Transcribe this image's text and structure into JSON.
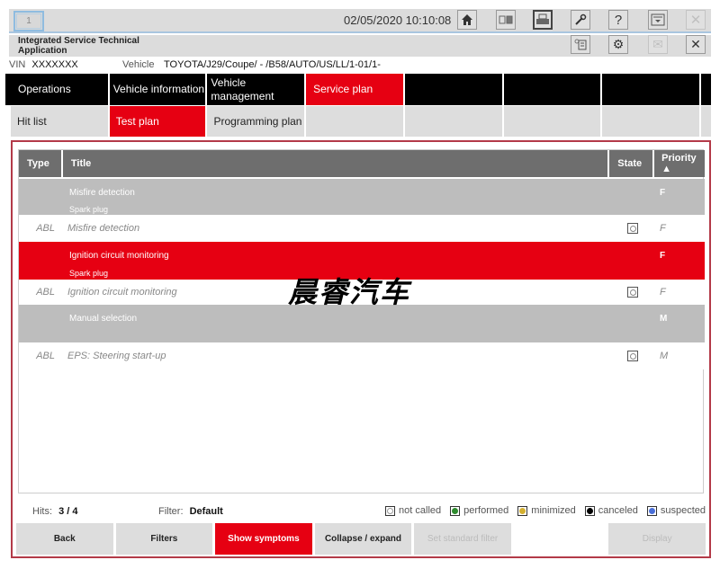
{
  "topbar": {
    "session_tab": "1",
    "datetime": "02/05/2020 10:10:08",
    "buttons": [
      {
        "name": "home",
        "icon": "⌂"
      },
      {
        "name": "split-view",
        "icon": "▫▪"
      },
      {
        "name": "print",
        "icon": "▤"
      },
      {
        "name": "wrench",
        "icon": "🔧"
      },
      {
        "name": "help",
        "icon": "?"
      },
      {
        "name": "download",
        "icon": "⤓"
      },
      {
        "name": "close-disabled",
        "icon": "✕"
      }
    ]
  },
  "appbar": {
    "title_line1": "Integrated Service Technical",
    "title_line2": "Application",
    "buttons": [
      {
        "name": "documents",
        "icon": "❐"
      },
      {
        "name": "settings",
        "icon": "⚙"
      },
      {
        "name": "mail",
        "icon": "✉"
      },
      {
        "name": "close",
        "icon": "✕"
      }
    ]
  },
  "vehicle": {
    "vin_label": "VIN",
    "vin_value": "XXXXXXX",
    "vehicle_label": "Vehicle",
    "vehicle_value": "TOYOTA/J29/Coupe/ - /B58/AUTO/US/LL/1-01/1-"
  },
  "nav_main": [
    {
      "label": "Operations",
      "active": false
    },
    {
      "label": "Vehicle information",
      "active": false
    },
    {
      "label": "Vehicle management",
      "active": false
    },
    {
      "label": "Service plan",
      "active": true
    },
    {
      "label": "",
      "active": false
    },
    {
      "label": "",
      "active": false
    },
    {
      "label": "",
      "active": false
    },
    {
      "label": "",
      "active": false
    }
  ],
  "nav_sub": [
    {
      "label": "Hit list",
      "active": false
    },
    {
      "label": "Test plan",
      "active": true
    },
    {
      "label": "Programming plan",
      "active": false
    },
    {
      "label": "",
      "active": false
    },
    {
      "label": "",
      "active": false
    },
    {
      "label": "",
      "active": false
    },
    {
      "label": "",
      "active": false
    },
    {
      "label": "",
      "active": false
    }
  ],
  "table": {
    "columns": {
      "type": "Type",
      "title": "Title",
      "state": "State",
      "priority": "Priority ▲"
    },
    "rows": [
      {
        "kind": "group",
        "title": "Misfire detection",
        "subtitle": "Spark plug",
        "priority": "F",
        "highlight": false
      },
      {
        "kind": "item",
        "type": "ABL",
        "title": "Misfire detection",
        "state": "not called",
        "priority": "F"
      },
      {
        "kind": "group",
        "title": "Ignition circuit monitoring",
        "subtitle": "Spark plug",
        "priority": "F",
        "highlight": true
      },
      {
        "kind": "item",
        "type": "ABL",
        "title": "Ignition circuit monitoring",
        "state": "not called",
        "priority": "F"
      },
      {
        "kind": "group",
        "title": "Manual selection",
        "subtitle": "",
        "priority": "M",
        "highlight": false
      },
      {
        "kind": "item",
        "type": "ABL",
        "title": "EPS: Steering start-up",
        "state": "not called",
        "priority": "M"
      }
    ]
  },
  "watermark": "晨睿汽车",
  "status": {
    "hits_label": "Hits:",
    "hits_value": "3 / 4",
    "filter_label": "Filter:",
    "filter_value": "Default"
  },
  "legend": [
    {
      "label": "not called",
      "color": "#ffffff"
    },
    {
      "label": "performed",
      "color": "#2e8b2e"
    },
    {
      "label": "minimized",
      "color": "#d4b030"
    },
    {
      "label": "canceled",
      "color": "#000000"
    },
    {
      "label": "suspected",
      "color": "#4a6fd8"
    }
  ],
  "actions": {
    "back": "Back",
    "filters": "Filters",
    "show_symptoms": "Show symptoms",
    "collapse_expand": "Collapse / expand",
    "set_standard_filter": "Set standard filter",
    "display": "Display"
  },
  "colors": {
    "accent": "#e60012",
    "nav_dark": "#000000",
    "header_gray": "#6e6e6e",
    "group_gray": "#bdbdbd"
  }
}
